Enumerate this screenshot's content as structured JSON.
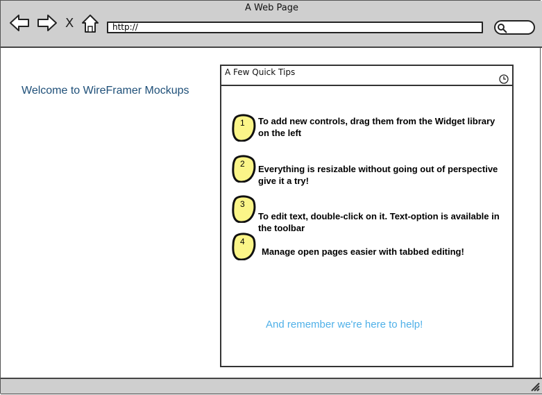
{
  "window": {
    "title": "A Web Page"
  },
  "toolbar": {
    "back_icon": "back-arrow-icon",
    "forward_icon": "forward-arrow-icon",
    "stop_label": "X",
    "home_icon": "home-icon",
    "url_value": "http://",
    "search_icon": "search-icon"
  },
  "main": {
    "welcome_text": "Welcome to WireFramer Mockups",
    "tips_panel": {
      "title": "A Few Quick Tips",
      "clock_icon": "clock-icon",
      "tips": [
        {
          "number": "1",
          "text": "To add new controls, drag them from the Widget library on the left"
        },
        {
          "number": "2",
          "text": "Everything is resizable without going out of perspective give it a try!"
        },
        {
          "number": "3",
          "text": "To edit text, double-click on it. Text-option is available in the toolbar"
        },
        {
          "number": "4",
          "text": "Manage open pages easier with tabbed editing!"
        }
      ],
      "help_text": "And remember we're here to help!"
    }
  },
  "colors": {
    "chrome": "#cfcfcf",
    "welcome": "#1e4f78",
    "badge": "#fbf588",
    "help": "#4fb0e8"
  },
  "statusbar": {
    "grip_icon": "resize-grip-icon"
  }
}
